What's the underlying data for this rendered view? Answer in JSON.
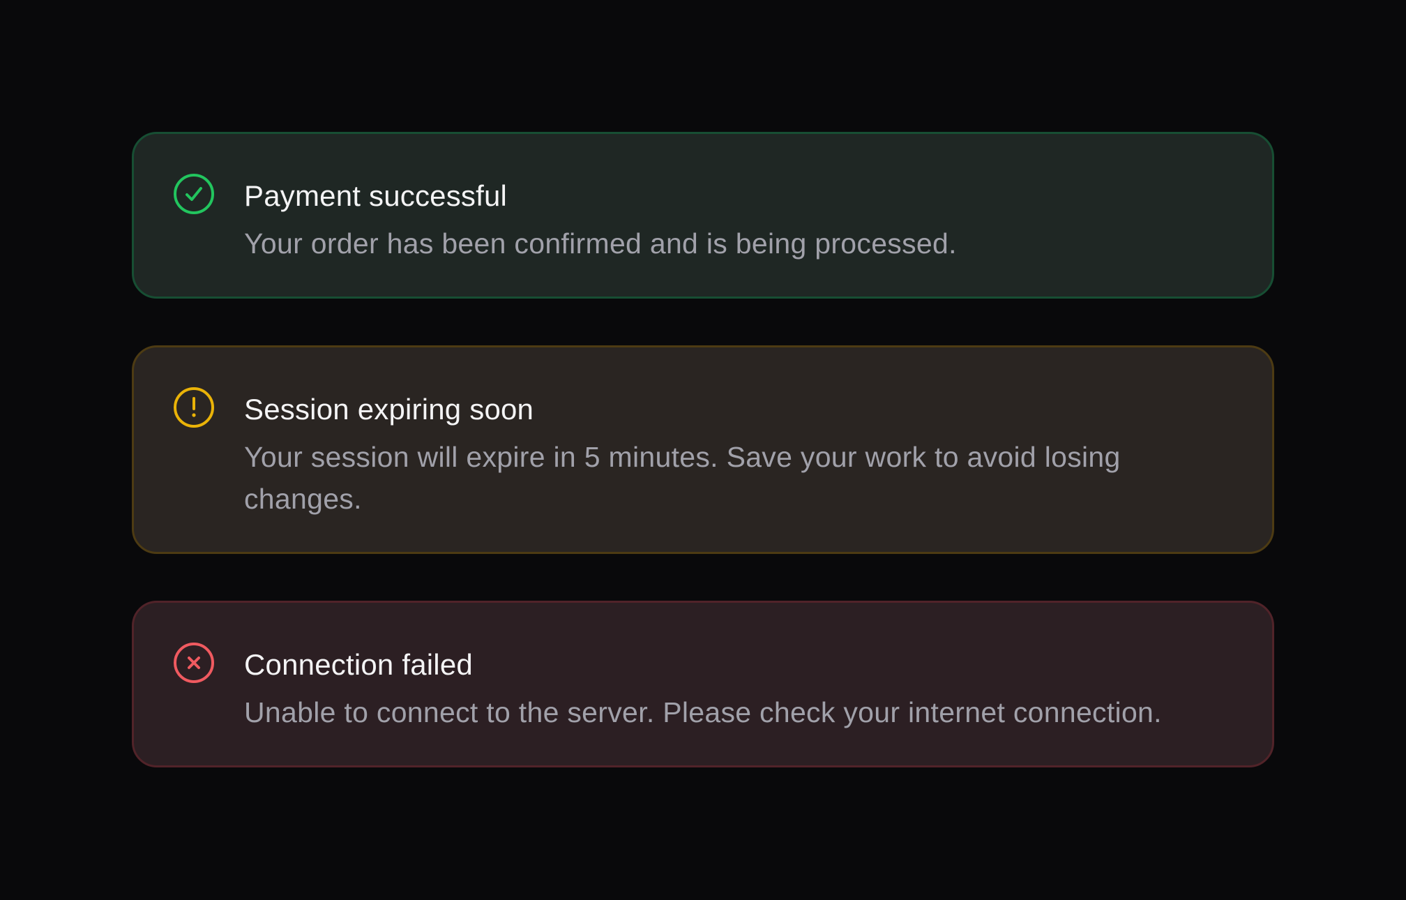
{
  "colors": {
    "background": "#09090b",
    "success_accent": "#22c55e",
    "warning_accent": "#eab308",
    "error_accent": "#f05a60"
  },
  "alerts": [
    {
      "variant": "success",
      "icon": "check-circle-icon",
      "title": "Payment successful",
      "message": "Your order has been confirmed and is being processed."
    },
    {
      "variant": "warning",
      "icon": "exclamation-circle-icon",
      "title": "Session expiring soon",
      "message": "Your session will expire in 5 minutes. Save your work to avoid losing changes."
    },
    {
      "variant": "error",
      "icon": "x-circle-icon",
      "title": "Connection failed",
      "message": "Unable to connect to the server. Please check your internet connection."
    }
  ]
}
